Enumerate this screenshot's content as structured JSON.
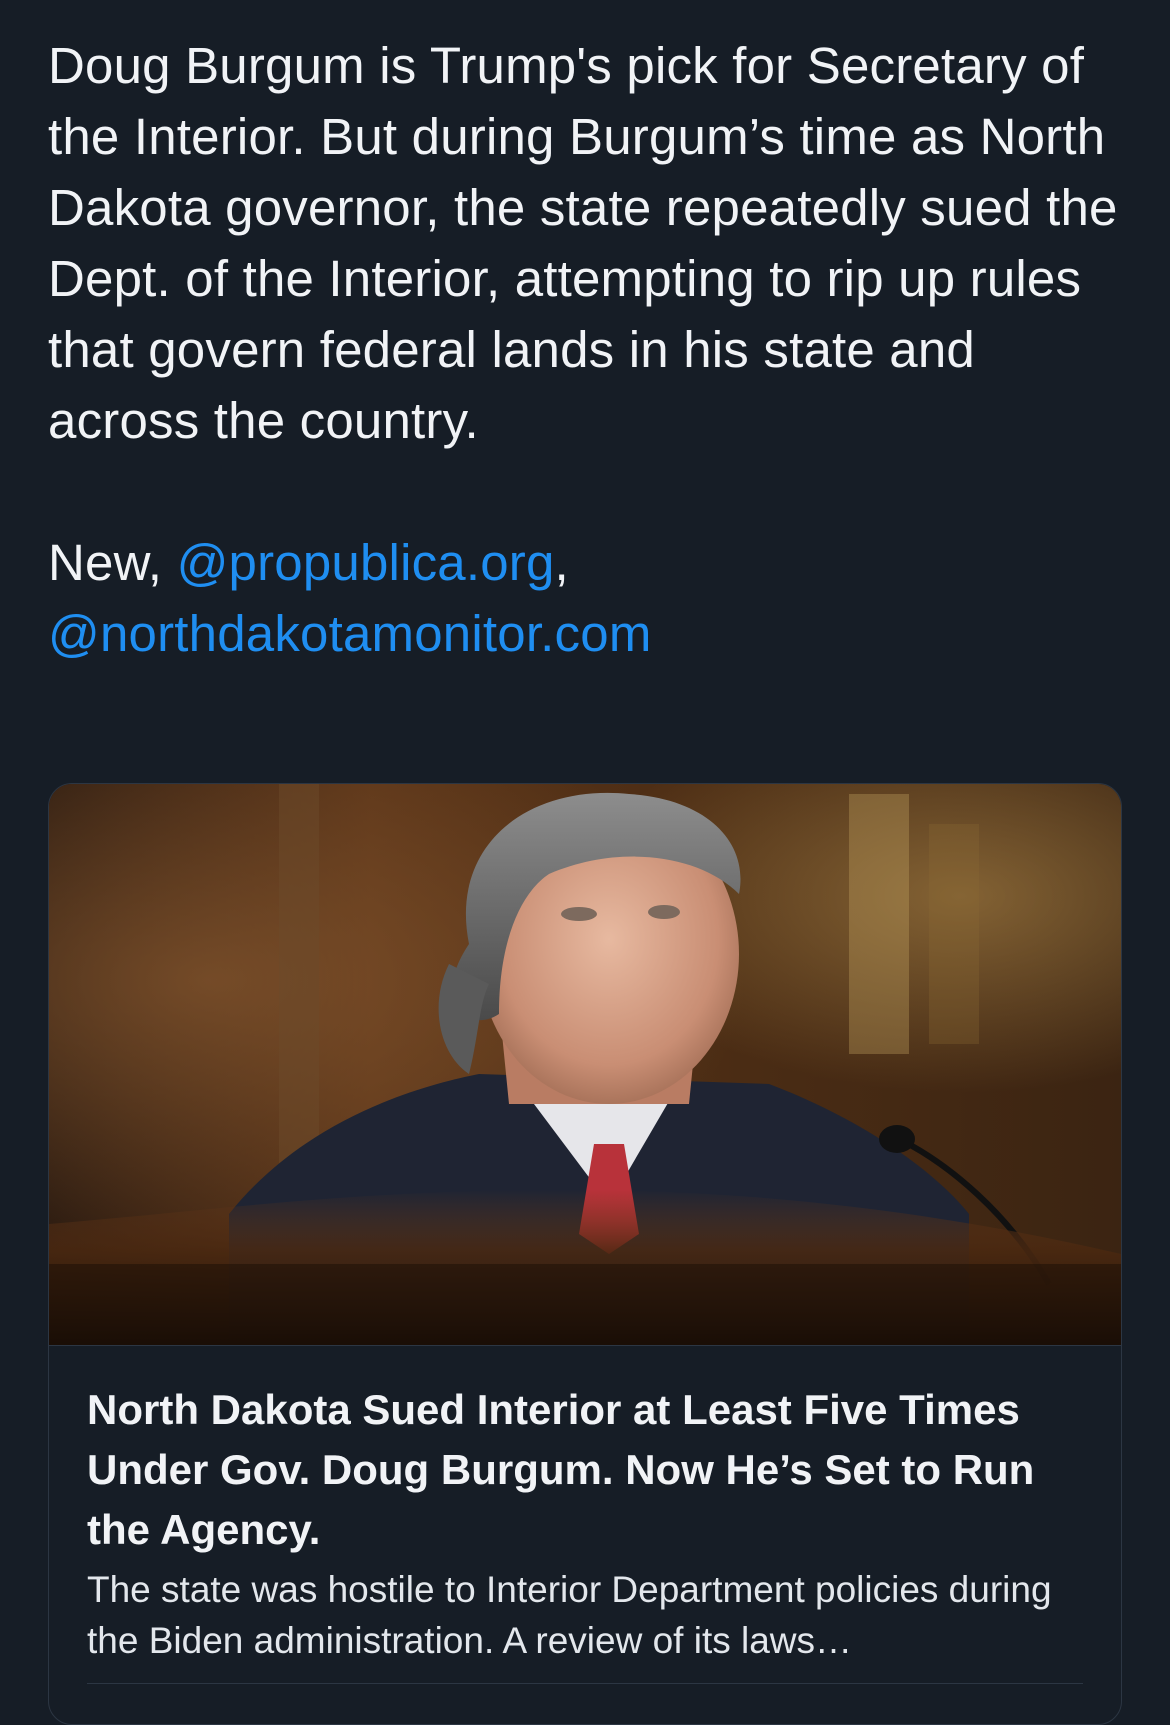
{
  "post": {
    "paragraph1": "Doug Burgum is Trump's pick for Secretary of the Interior. But during Burgum’s time as North Dakota governor, the state repeatedly sued the Dept. of the Interior, attempting to rip up rules that govern federal lands in his state and across the country.",
    "paragraph2_prefix": "New, ",
    "mention1": "@propublica.org",
    "separator": ",",
    "mention2": "@northdakotamonitor.com"
  },
  "link_card": {
    "image_alt": "Doug Burgum seated at a hearing with a microphone",
    "title": "North Dakota Sued Interior at Least Five Times Under Gov. Doug Burgum. Now He’s Set to Run the Agency.",
    "description": "The state was hostile to Interior Department policies during the Biden administration. A review of its laws…"
  },
  "colors": {
    "background": "#161d26",
    "text": "#f1f3f6",
    "link": "#1f8ef1",
    "border": "#2c3643"
  }
}
